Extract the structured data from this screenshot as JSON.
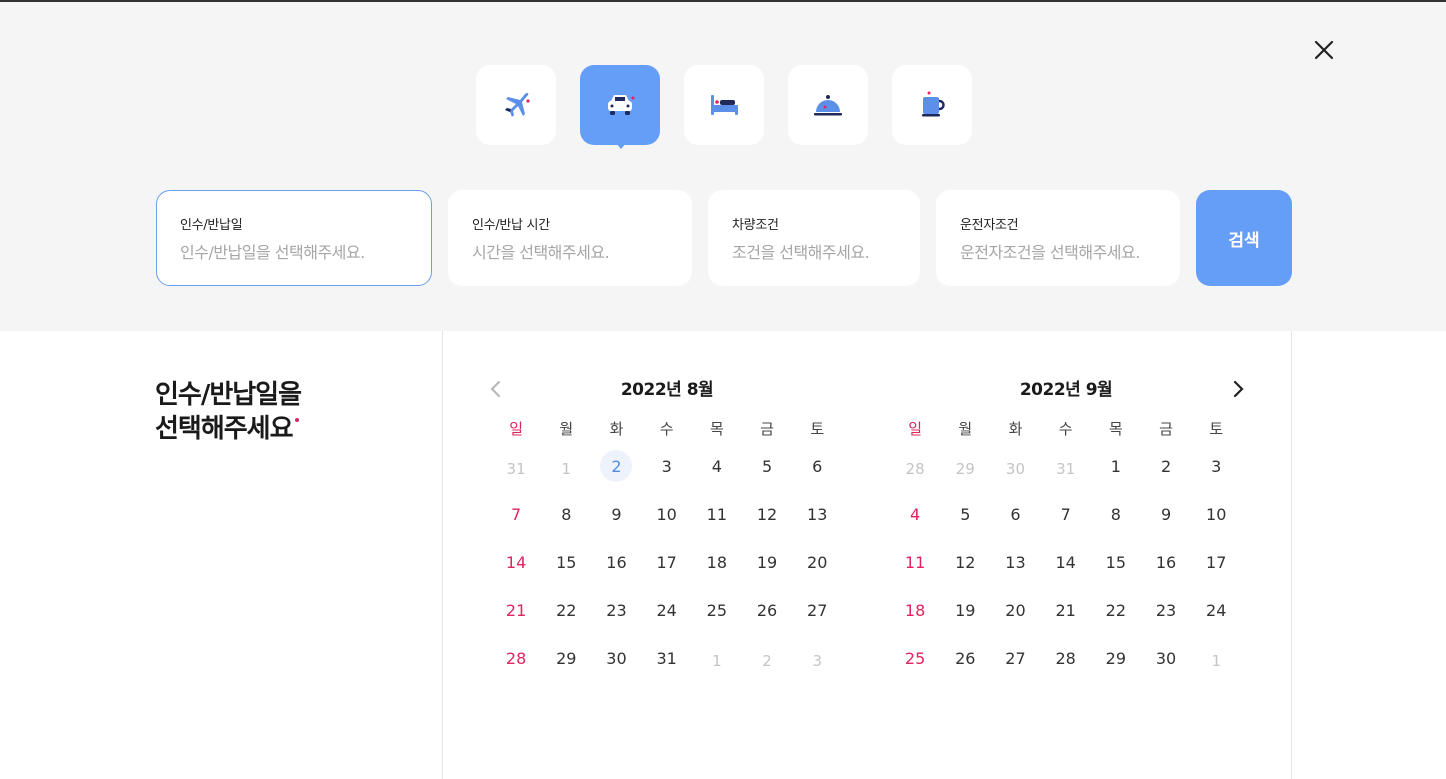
{
  "categories": [
    {
      "id": "flight",
      "icon": "airplane-icon"
    },
    {
      "id": "car",
      "icon": "car-icon",
      "active": true
    },
    {
      "id": "hotel",
      "icon": "bed-icon"
    },
    {
      "id": "restaurant",
      "icon": "cloche-icon"
    },
    {
      "id": "cafe",
      "icon": "coffee-cup-icon"
    }
  ],
  "fields": [
    {
      "label": "인수/반납일",
      "placeholder": "인수/반납일을 선택해주세요."
    },
    {
      "label": "인수/반납 시간",
      "placeholder": "시간을 선택해주세요."
    },
    {
      "label": "차량조건",
      "placeholder": "조건을 선택해주세요."
    },
    {
      "label": "운전자조건",
      "placeholder": "운전자조건을 선택해주세요."
    }
  ],
  "search_label": "검색",
  "side_title": {
    "line1": "인수/반납일을",
    "line2": "선택해주세요"
  },
  "weekdays": [
    "일",
    "월",
    "화",
    "수",
    "목",
    "금",
    "토"
  ],
  "calendars": [
    {
      "title": "2022년 8월",
      "weeks": [
        [
          {
            "d": "31",
            "m": 1
          },
          {
            "d": "1",
            "m": 1
          },
          {
            "d": "2",
            "t": 1
          },
          {
            "d": "3"
          },
          {
            "d": "4"
          },
          {
            "d": "5"
          },
          {
            "d": "6"
          }
        ],
        [
          {
            "d": "7"
          },
          {
            "d": "8"
          },
          {
            "d": "9"
          },
          {
            "d": "10"
          },
          {
            "d": "11"
          },
          {
            "d": "12"
          },
          {
            "d": "13"
          }
        ],
        [
          {
            "d": "14"
          },
          {
            "d": "15"
          },
          {
            "d": "16"
          },
          {
            "d": "17"
          },
          {
            "d": "18"
          },
          {
            "d": "19"
          },
          {
            "d": "20"
          }
        ],
        [
          {
            "d": "21"
          },
          {
            "d": "22"
          },
          {
            "d": "23"
          },
          {
            "d": "24"
          },
          {
            "d": "25"
          },
          {
            "d": "26"
          },
          {
            "d": "27"
          }
        ],
        [
          {
            "d": "28"
          },
          {
            "d": "29"
          },
          {
            "d": "30"
          },
          {
            "d": "31"
          },
          {
            "d": "1",
            "m": 1
          },
          {
            "d": "2",
            "m": 1
          },
          {
            "d": "3",
            "m": 1
          }
        ]
      ]
    },
    {
      "title": "2022년 9월",
      "weeks": [
        [
          {
            "d": "28",
            "m": 1
          },
          {
            "d": "29",
            "m": 1
          },
          {
            "d": "30",
            "m": 1
          },
          {
            "d": "31",
            "m": 1
          },
          {
            "d": "1"
          },
          {
            "d": "2"
          },
          {
            "d": "3"
          }
        ],
        [
          {
            "d": "4"
          },
          {
            "d": "5"
          },
          {
            "d": "6"
          },
          {
            "d": "7"
          },
          {
            "d": "8"
          },
          {
            "d": "9"
          },
          {
            "d": "10"
          }
        ],
        [
          {
            "d": "11"
          },
          {
            "d": "12"
          },
          {
            "d": "13"
          },
          {
            "d": "14"
          },
          {
            "d": "15"
          },
          {
            "d": "16"
          },
          {
            "d": "17"
          }
        ],
        [
          {
            "d": "18"
          },
          {
            "d": "19"
          },
          {
            "d": "20"
          },
          {
            "d": "21"
          },
          {
            "d": "22"
          },
          {
            "d": "23"
          },
          {
            "d": "24"
          }
        ],
        [
          {
            "d": "25"
          },
          {
            "d": "26"
          },
          {
            "d": "27"
          },
          {
            "d": "28"
          },
          {
            "d": "29"
          },
          {
            "d": "30"
          },
          {
            "d": "1",
            "m": 1
          }
        ]
      ]
    }
  ],
  "colors": {
    "accent": "#659ef7",
    "sunday": "#e0245e",
    "muted": "#c4c4c4"
  }
}
